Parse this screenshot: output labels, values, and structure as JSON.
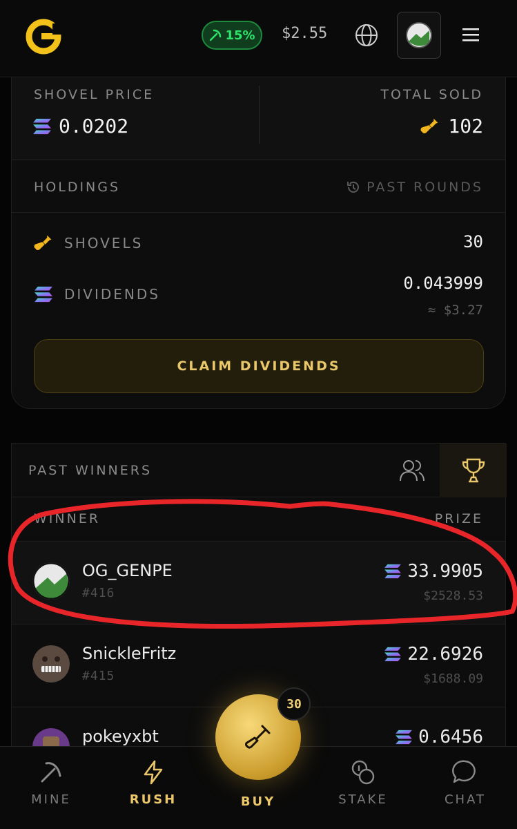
{
  "header": {
    "boost_label": "15%",
    "price_label": "$2.55"
  },
  "stats": {
    "shovel_price_label": "SHOVEL PRICE",
    "shovel_price_value": "0.0202",
    "total_sold_label": "TOTAL SOLD",
    "total_sold_value": "102"
  },
  "holdings": {
    "title": "HOLDINGS",
    "past_rounds_label": "PAST ROUNDS",
    "shovels_label": "SHOVELS",
    "shovels_value": "30",
    "dividends_label": "DIVIDENDS",
    "dividends_value": "0.043999",
    "dividends_usd": "≈ $3.27",
    "claim_label": "CLAIM DIVIDENDS"
  },
  "past_winners": {
    "title": "PAST WINNERS",
    "col_winner": "WINNER",
    "col_prize": "PRIZE",
    "rows": [
      {
        "name": "OG_GENPE",
        "round": "#416",
        "prize": "33.9905",
        "usd": "$2528.53"
      },
      {
        "name": "SnickleFritz",
        "round": "#415",
        "prize": "22.6926",
        "usd": "$1688.09"
      },
      {
        "name": "pokeyxbt",
        "round": "",
        "prize": "0.6456",
        "usd": ""
      }
    ]
  },
  "nav": {
    "mine": "MINE",
    "rush": "RUSH",
    "buy": "BUY",
    "buy_badge": "30",
    "stake": "STAKE",
    "chat": "CHAT"
  },
  "colors": {
    "accent_gold": "#e9c76a",
    "boost_green": "#2ee36b",
    "annotation_red": "#e8262a"
  }
}
